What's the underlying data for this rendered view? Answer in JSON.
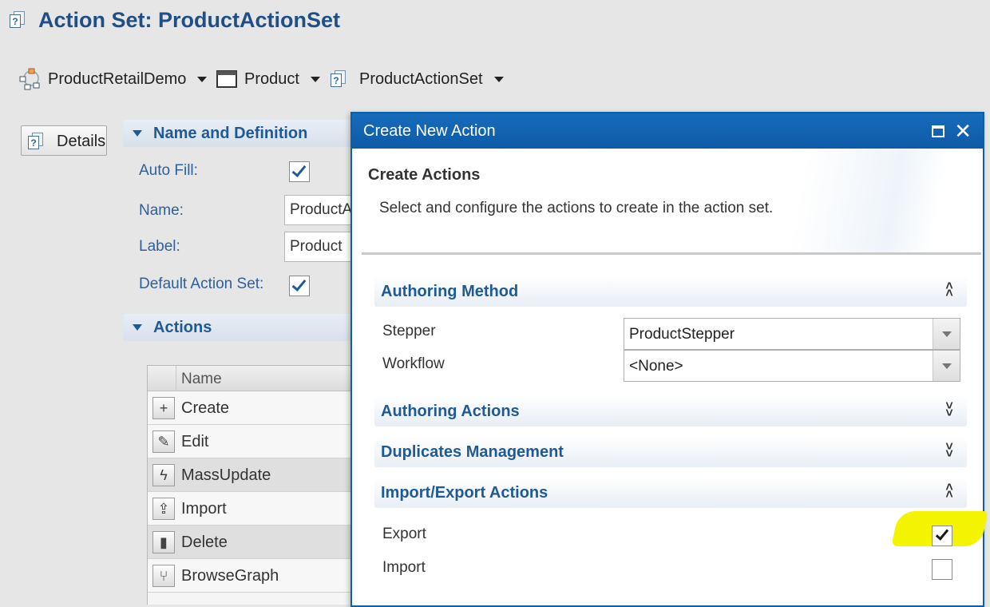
{
  "page": {
    "title": "Action Set: ProductActionSet"
  },
  "breadcrumb": [
    {
      "label": "ProductRetailDemo",
      "icon": "app-hierarchy-icon"
    },
    {
      "label": "Product",
      "icon": "window-icon"
    },
    {
      "label": "ProductActionSet",
      "icon": "document-help-icon"
    }
  ],
  "details_button": {
    "label": "Details"
  },
  "name_definition": {
    "title": "Name and Definition",
    "auto_fill_label": "Auto Fill:",
    "auto_fill_checked": true,
    "name_label": "Name:",
    "name_value": "ProductA",
    "label_label": "Label:",
    "label_value": "Product",
    "default_label": "Default Action Set:",
    "default_checked": true
  },
  "actions_section": {
    "title": "Actions",
    "column_header": "Name",
    "rows": [
      {
        "label": "Create",
        "icon": "plus-icon"
      },
      {
        "label": "Edit",
        "icon": "pencil-icon"
      },
      {
        "label": "MassUpdate",
        "icon": "lightning-icon"
      },
      {
        "label": "Import",
        "icon": "upload-icon"
      },
      {
        "label": "Delete",
        "icon": "trash-icon"
      },
      {
        "label": "BrowseGraph",
        "icon": "branch-icon"
      }
    ]
  },
  "dialog": {
    "title": "Create New Action",
    "heading": "Create Actions",
    "description": "Select and configure the actions to create in the action set.",
    "authoring_method": {
      "title": "Authoring Method",
      "stepper_label": "Stepper",
      "stepper_value": "ProductStepper",
      "workflow_label": "Workflow",
      "workflow_value": "<None>"
    },
    "authoring_actions_title": "Authoring Actions",
    "duplicates_title": "Duplicates Management",
    "import_export": {
      "title": "Import/Export Actions",
      "export_label": "Export",
      "export_checked": true,
      "import_label": "Import",
      "import_checked": false
    },
    "highlight_color": "#f4f400"
  },
  "colors": {
    "accent": "#1f5a96",
    "titlebar": "#0e5ea9"
  }
}
